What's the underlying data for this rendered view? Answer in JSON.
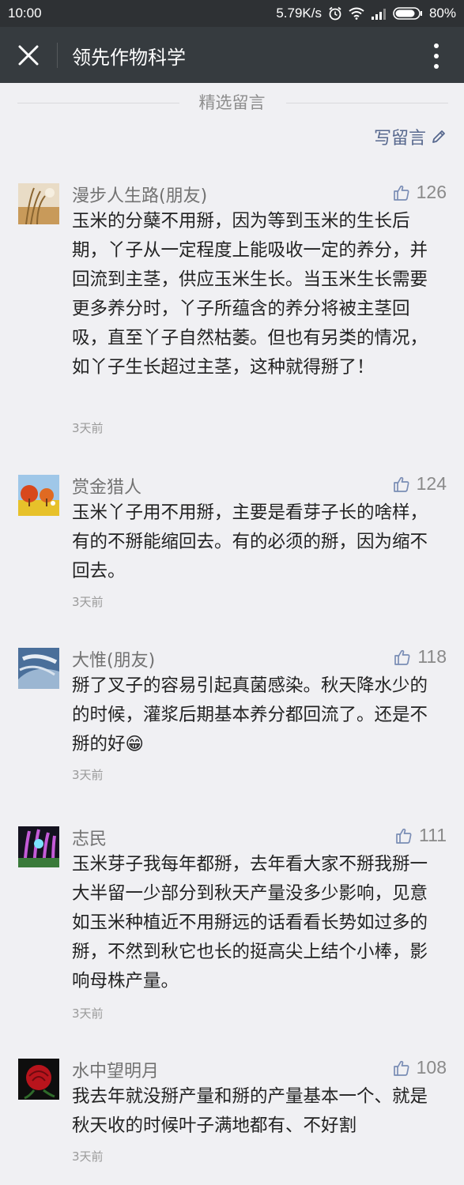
{
  "status_bar": {
    "time": "10:00",
    "speed": "5.79K/s",
    "battery": "80%"
  },
  "header": {
    "title": "领先作物科学"
  },
  "section": {
    "title": "精选留言",
    "write_label": "写留言"
  },
  "comments": [
    {
      "name": "漫步人生路(朋友)",
      "likes": "126",
      "text": "玉米的分蘖不用掰，因为等到玉米的生长后期，丫子从一定程度上能吸收一定的养分，并回流到主茎，供应玉米生长。当玉米生长需要更多养分时，丫子所蕴含的养分将被主茎回吸，直至丫子自然枯萎。但也有另类的情况，如丫子生长超过主茎，这种就得掰了！",
      "time": "3天前"
    },
    {
      "name": "赏金猎人",
      "likes": "124",
      "text": "玉米丫子用不用掰，主要是看芽子长的啥样，有的不掰能缩回去。有的必须的掰，因为缩不回去。",
      "time": "3天前"
    },
    {
      "name": "大惟(朋友)",
      "likes": "118",
      "text": "掰了叉子的容易引起真菌感染。秋天降水少的的时候，灌浆后期基本养分都回流了。还是不掰的好😁",
      "time": "3天前"
    },
    {
      "name": "志民",
      "likes": "111",
      "text": "玉米芽子我每年都掰，去年看大家不掰我掰一大半留一少部分到秋天产量没多少影响，见意如玉米种植近不用掰远的话看看长势如过多的掰，不然到秋它也长的挺高尖上结个小棒，影响母株产量。",
      "time": "3天前"
    },
    {
      "name": "水中望明月",
      "likes": "108",
      "text": "我去年就没掰产量和掰的产量基本一个、就是秋天收的时候叶子满地都有、不好割",
      "time": "3天前"
    }
  ]
}
